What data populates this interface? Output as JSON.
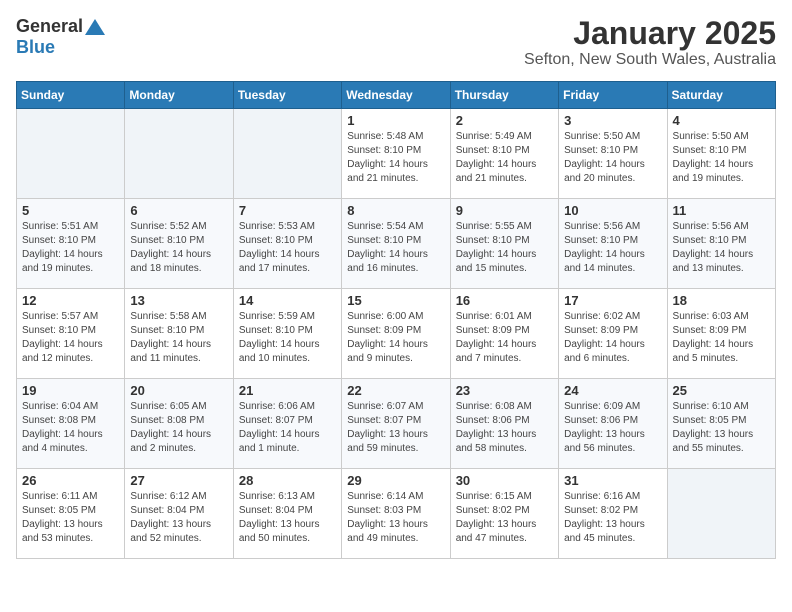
{
  "logo": {
    "general": "General",
    "blue": "Blue"
  },
  "title": "January 2025",
  "subtitle": "Sefton, New South Wales, Australia",
  "days_of_week": [
    "Sunday",
    "Monday",
    "Tuesday",
    "Wednesday",
    "Thursday",
    "Friday",
    "Saturday"
  ],
  "weeks": [
    [
      {
        "day": "",
        "info": ""
      },
      {
        "day": "",
        "info": ""
      },
      {
        "day": "",
        "info": ""
      },
      {
        "day": "1",
        "info": "Sunrise: 5:48 AM\nSunset: 8:10 PM\nDaylight: 14 hours\nand 21 minutes."
      },
      {
        "day": "2",
        "info": "Sunrise: 5:49 AM\nSunset: 8:10 PM\nDaylight: 14 hours\nand 21 minutes."
      },
      {
        "day": "3",
        "info": "Sunrise: 5:50 AM\nSunset: 8:10 PM\nDaylight: 14 hours\nand 20 minutes."
      },
      {
        "day": "4",
        "info": "Sunrise: 5:50 AM\nSunset: 8:10 PM\nDaylight: 14 hours\nand 19 minutes."
      }
    ],
    [
      {
        "day": "5",
        "info": "Sunrise: 5:51 AM\nSunset: 8:10 PM\nDaylight: 14 hours\nand 19 minutes."
      },
      {
        "day": "6",
        "info": "Sunrise: 5:52 AM\nSunset: 8:10 PM\nDaylight: 14 hours\nand 18 minutes."
      },
      {
        "day": "7",
        "info": "Sunrise: 5:53 AM\nSunset: 8:10 PM\nDaylight: 14 hours\nand 17 minutes."
      },
      {
        "day": "8",
        "info": "Sunrise: 5:54 AM\nSunset: 8:10 PM\nDaylight: 14 hours\nand 16 minutes."
      },
      {
        "day": "9",
        "info": "Sunrise: 5:55 AM\nSunset: 8:10 PM\nDaylight: 14 hours\nand 15 minutes."
      },
      {
        "day": "10",
        "info": "Sunrise: 5:56 AM\nSunset: 8:10 PM\nDaylight: 14 hours\nand 14 minutes."
      },
      {
        "day": "11",
        "info": "Sunrise: 5:56 AM\nSunset: 8:10 PM\nDaylight: 14 hours\nand 13 minutes."
      }
    ],
    [
      {
        "day": "12",
        "info": "Sunrise: 5:57 AM\nSunset: 8:10 PM\nDaylight: 14 hours\nand 12 minutes."
      },
      {
        "day": "13",
        "info": "Sunrise: 5:58 AM\nSunset: 8:10 PM\nDaylight: 14 hours\nand 11 minutes."
      },
      {
        "day": "14",
        "info": "Sunrise: 5:59 AM\nSunset: 8:10 PM\nDaylight: 14 hours\nand 10 minutes."
      },
      {
        "day": "15",
        "info": "Sunrise: 6:00 AM\nSunset: 8:09 PM\nDaylight: 14 hours\nand 9 minutes."
      },
      {
        "day": "16",
        "info": "Sunrise: 6:01 AM\nSunset: 8:09 PM\nDaylight: 14 hours\nand 7 minutes."
      },
      {
        "day": "17",
        "info": "Sunrise: 6:02 AM\nSunset: 8:09 PM\nDaylight: 14 hours\nand 6 minutes."
      },
      {
        "day": "18",
        "info": "Sunrise: 6:03 AM\nSunset: 8:09 PM\nDaylight: 14 hours\nand 5 minutes."
      }
    ],
    [
      {
        "day": "19",
        "info": "Sunrise: 6:04 AM\nSunset: 8:08 PM\nDaylight: 14 hours\nand 4 minutes."
      },
      {
        "day": "20",
        "info": "Sunrise: 6:05 AM\nSunset: 8:08 PM\nDaylight: 14 hours\nand 2 minutes."
      },
      {
        "day": "21",
        "info": "Sunrise: 6:06 AM\nSunset: 8:07 PM\nDaylight: 14 hours\nand 1 minute."
      },
      {
        "day": "22",
        "info": "Sunrise: 6:07 AM\nSunset: 8:07 PM\nDaylight: 13 hours\nand 59 minutes."
      },
      {
        "day": "23",
        "info": "Sunrise: 6:08 AM\nSunset: 8:06 PM\nDaylight: 13 hours\nand 58 minutes."
      },
      {
        "day": "24",
        "info": "Sunrise: 6:09 AM\nSunset: 8:06 PM\nDaylight: 13 hours\nand 56 minutes."
      },
      {
        "day": "25",
        "info": "Sunrise: 6:10 AM\nSunset: 8:05 PM\nDaylight: 13 hours\nand 55 minutes."
      }
    ],
    [
      {
        "day": "26",
        "info": "Sunrise: 6:11 AM\nSunset: 8:05 PM\nDaylight: 13 hours\nand 53 minutes."
      },
      {
        "day": "27",
        "info": "Sunrise: 6:12 AM\nSunset: 8:04 PM\nDaylight: 13 hours\nand 52 minutes."
      },
      {
        "day": "28",
        "info": "Sunrise: 6:13 AM\nSunset: 8:04 PM\nDaylight: 13 hours\nand 50 minutes."
      },
      {
        "day": "29",
        "info": "Sunrise: 6:14 AM\nSunset: 8:03 PM\nDaylight: 13 hours\nand 49 minutes."
      },
      {
        "day": "30",
        "info": "Sunrise: 6:15 AM\nSunset: 8:02 PM\nDaylight: 13 hours\nand 47 minutes."
      },
      {
        "day": "31",
        "info": "Sunrise: 6:16 AM\nSunset: 8:02 PM\nDaylight: 13 hours\nand 45 minutes."
      },
      {
        "day": "",
        "info": ""
      }
    ]
  ]
}
